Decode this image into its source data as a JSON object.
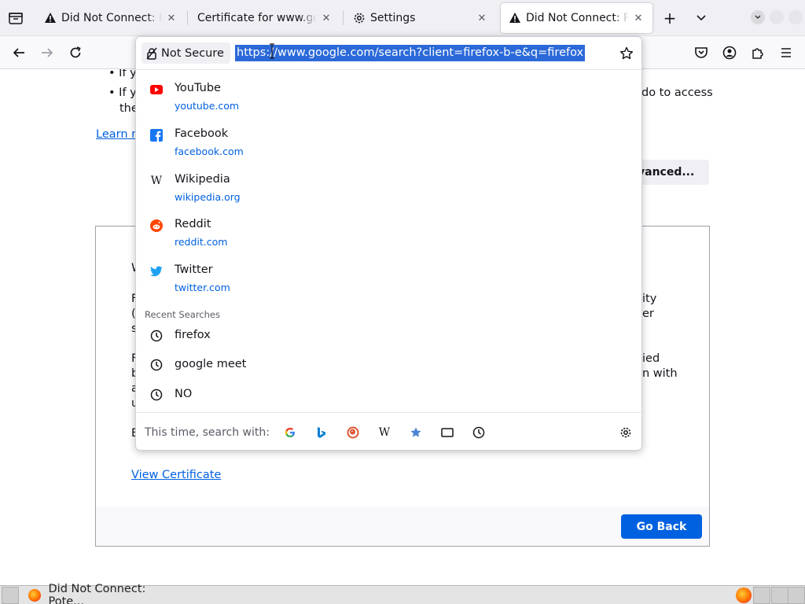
{
  "tabs": [
    {
      "title": "Did Not Connect: Potential Security Issue",
      "icon": "warning-icon",
      "selected": false
    },
    {
      "title": "Certificate for www.google.com",
      "icon": "none",
      "selected": false
    },
    {
      "title": "Settings",
      "icon": "gear-icon",
      "selected": false
    },
    {
      "title": "Did Not Connect: Potential Security Issue",
      "icon": "warning-icon",
      "selected": true
    }
  ],
  "urlbar": {
    "identity_label": "Not Secure",
    "url": "https://www.google.com/search?client=firefox-b-e&q=firefox"
  },
  "suggestions": [
    {
      "title": "YouTube",
      "url": "youtube.com",
      "icon": "youtube-icon",
      "color": "#ff0000"
    },
    {
      "title": "Facebook",
      "url": "facebook.com",
      "icon": "facebook-icon",
      "color": "#1877f2"
    },
    {
      "title": "Wikipedia",
      "url": "wikipedia.org",
      "icon": "wikipedia-icon",
      "color": "#000000"
    },
    {
      "title": "Reddit",
      "url": "reddit.com",
      "icon": "reddit-icon",
      "color": "#ff4500"
    },
    {
      "title": "Twitter",
      "url": "twitter.com",
      "icon": "twitter-icon",
      "color": "#1da1f2"
    }
  ],
  "recent_searches": {
    "heading": "Recent Searches",
    "items": [
      "firefox",
      "google meet",
      "NO"
    ]
  },
  "search_with": {
    "label": "This time, search with:",
    "engines": [
      "google-icon",
      "bing-icon",
      "duckduckgo-icon",
      "wikipedia-icon",
      "bookmarks-icon",
      "tabs-icon",
      "history-icon"
    ]
  },
  "page": {
    "bullet1_prefix": "If y",
    "bullet2_prefix": "If y",
    "bullet2_suffix": "do to access",
    "bullet2_line2": "the",
    "learn_more": "Learn m",
    "advanced_button": "vanced...",
    "view_certificate": "View Certificate",
    "go_back": "Go Back",
    "fragments": [
      "W",
      "F",
      "(",
      "s",
      "F",
      "b",
      "a",
      "u",
      "E",
      "ity",
      "er",
      "ied",
      "n with"
    ]
  },
  "taskbar": {
    "window_title": "Did Not Connect: Pote..."
  },
  "colors": {
    "accent": "#0061e0",
    "selection": "#2b69d8"
  }
}
